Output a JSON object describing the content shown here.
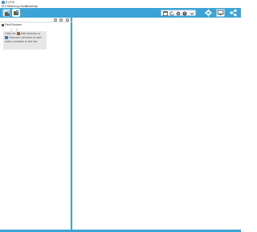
{
  "window": {
    "title": "ELPIS"
  },
  "menu": {
    "items": [
      "ELPIS",
      "Memory Mode",
      "Tools",
      "Help"
    ]
  },
  "toolbar": {
    "left_buttons": [
      "device-scan-icon",
      "device-list-icon"
    ],
    "group_icons": [
      "window-icon",
      "refresh-icon",
      "settings-icon",
      "help-icon"
    ],
    "right_buttons": [
      "gear-icon",
      "monitor-icon",
      "share-icon"
    ]
  },
  "panel": {
    "header": "Field Devices",
    "tooltip": {
      "line1a": "Click on",
      "line1b": "Add devices or",
      "line2": "Discover devices to add",
      "line3": "radio modules to the list."
    }
  },
  "colors": {
    "accent": "#3ca3d6",
    "tooltip_bg": "#e7e7e7"
  }
}
